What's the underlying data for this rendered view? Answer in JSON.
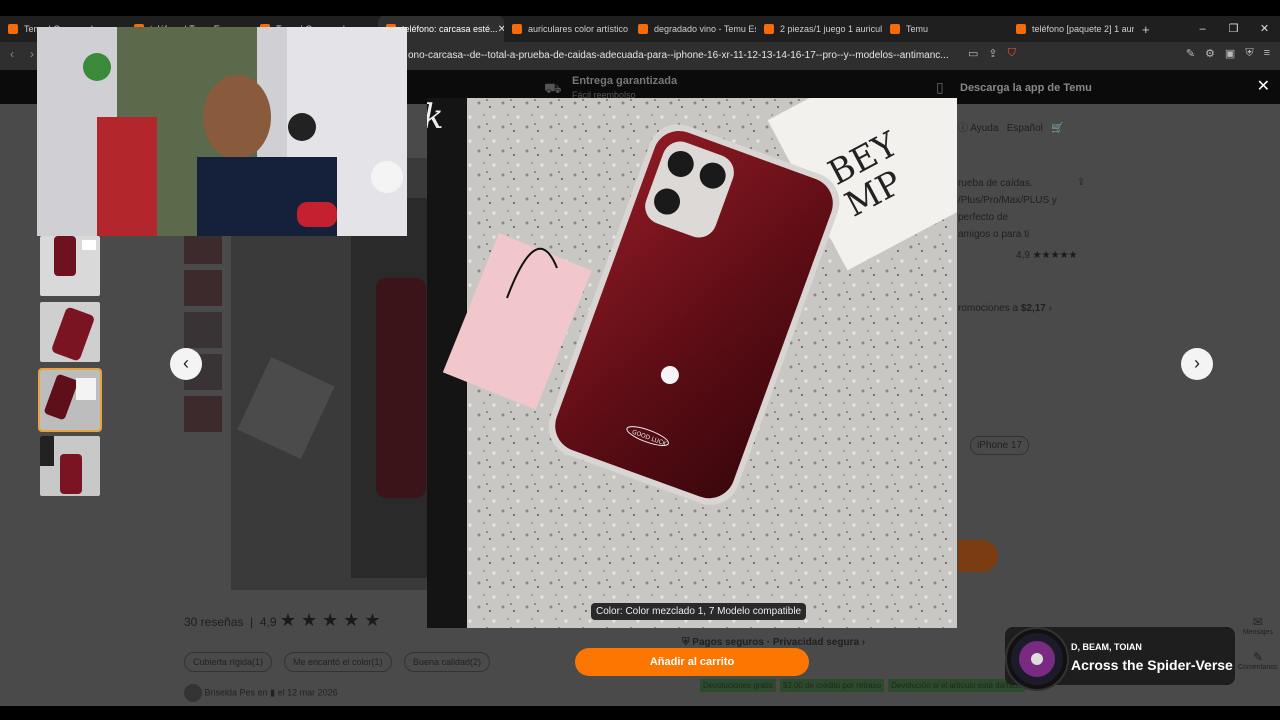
{
  "tabs": [
    {
      "label": "Temu | Compra de...",
      "active": false
    },
    {
      "label": "teléfono | Temu Es...",
      "active": false
    },
    {
      "label": "Temu | Compra de...",
      "active": false
    },
    {
      "label": "teléfono: carcasa esté...",
      "active": true
    },
    {
      "label": "auriculares color artístico",
      "active": false
    },
    {
      "label": "degradado vino - Temu Es",
      "active": false
    },
    {
      "label": "2 piezas/1 juego 1 auricula",
      "active": false
    },
    {
      "label": "Temu",
      "active": false
    },
    {
      "label": "teléfono [paquete 2] 1 auri",
      "active": false
    }
  ],
  "window_controls": [
    "–",
    "❐",
    "✕"
  ],
  "url": "ono-carcasa--de--total-a-prueba-de-caidas-adecuada-para--iphone-16-xr-11-12-13-14-16-17--pro--y--modelos--antimanc...",
  "promo": {
    "guaranteed": "Entrega garantizada",
    "refund": "Fácil reembolso",
    "app": "Descarga la app de Temu"
  },
  "header_right": {
    "help": "Ayuda",
    "language": "Español"
  },
  "product_desc": [
    "rueba de caídas.",
    "/Plus/Pro/Max/PLUS y",
    "perfecto de",
    "amigos o para ti"
  ],
  "product_rating": "4,9",
  "promo_price_prefix": "romociones a",
  "promo_price": "$2,17",
  "model_chip": "iPhone 17",
  "caption": "Color: Color mezclado 1, 7 Modelo compatible",
  "add_to_cart": "Añadir al carrito",
  "reviews": {
    "count_label": "30 reseñas",
    "rating": "4,9"
  },
  "review_chips": [
    "Cubierta rígida(1)",
    "Me encantó el color(1)",
    "Buena calidad(2)"
  ],
  "reviewer": {
    "name": "Briselda Pes",
    "meta": "en",
    "date": "el 12 mar 2026"
  },
  "secure_payment": "Pagos seguros · Privacidad segura",
  "shipping_badges": [
    "Devoluciones gratis",
    "$3,00 de crédito por retraso",
    "Devolución si el artículo está dañado"
  ],
  "now_playing": {
    "artist": "D, BEAM, TOIAN",
    "song": "Across the Spider-Verse"
  },
  "side_labels": [
    "Mensajes",
    "Comentarios"
  ],
  "case_text": "GOOD LUCK",
  "book_text": [
    "BEY",
    "MP"
  ],
  "bg_text": [
    "ok",
    "k"
  ]
}
